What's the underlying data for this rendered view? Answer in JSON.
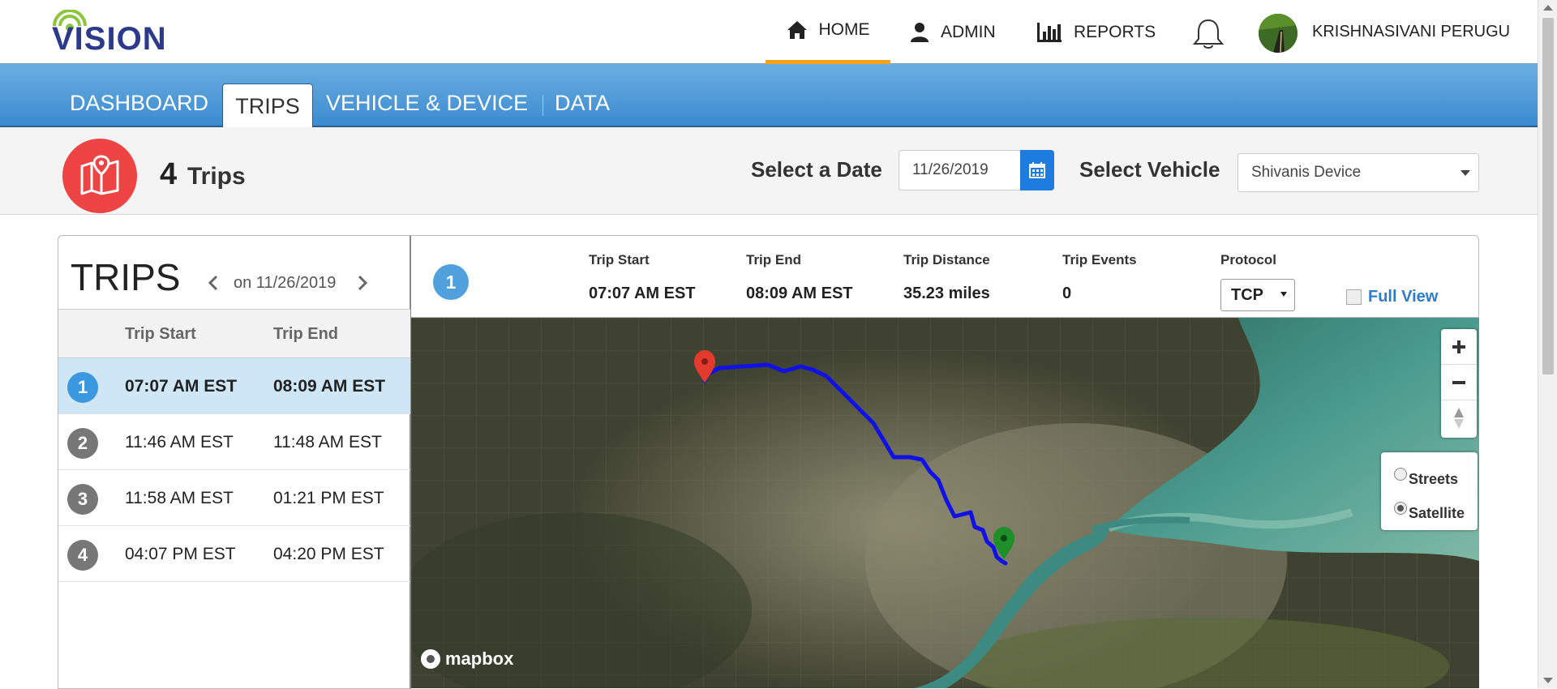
{
  "header": {
    "logo_text": "VISION",
    "nav": [
      {
        "label": "HOME",
        "icon": "home-icon"
      },
      {
        "label": "ADMIN",
        "icon": "user-icon"
      },
      {
        "label": "REPORTS",
        "icon": "bar-chart-icon"
      }
    ],
    "username": "KRISHNASIVANI PERUGU",
    "active_nav_color": "#f7a21b"
  },
  "tabs": {
    "items": [
      "DASHBOARD",
      "TRIPS",
      "VEHICLE & DEVICE",
      "DATA"
    ],
    "active": "TRIPS",
    "bar_color": "#3c8bd0"
  },
  "summary": {
    "trip_count": "4",
    "trip_count_label": "Trips",
    "date_label": "Select a Date",
    "date_value": "11/26/2019",
    "vehicle_label": "Select Vehicle",
    "vehicle_value": "Shivanis Device"
  },
  "trips": {
    "title": "TRIPS",
    "date_text": "on 11/26/2019",
    "columns": [
      "Trip Start",
      "Trip End"
    ],
    "rows": [
      {
        "num": "1",
        "start": "07:07 AM EST",
        "end": "08:09 AM EST",
        "selected": true
      },
      {
        "num": "2",
        "start": "11:46 AM EST",
        "end": "11:48 AM EST",
        "selected": false
      },
      {
        "num": "3",
        "start": "11:58 AM EST",
        "end": "01:21 PM EST",
        "selected": false
      },
      {
        "num": "4",
        "start": "04:07 PM EST",
        "end": "04:20 PM EST",
        "selected": false
      }
    ]
  },
  "detail": {
    "num": "1",
    "fields": [
      {
        "label": "Trip Start",
        "value": "07:07 AM EST"
      },
      {
        "label": "Trip End",
        "value": "08:09 AM EST"
      },
      {
        "label": "Trip Distance",
        "value": "35.23 miles"
      },
      {
        "label": "Trip Events",
        "value": "0"
      }
    ],
    "protocol_label": "Protocol",
    "protocol_value": "TCP",
    "full_view": "Full View"
  },
  "map": {
    "layers": [
      {
        "label": "Streets",
        "checked": false
      },
      {
        "label": "Satellite",
        "checked": true
      }
    ],
    "attribution": "mapbox",
    "route_color": "#1010e8",
    "start_marker_color": "#e23b2e",
    "end_marker_color": "#1f8f2a"
  }
}
